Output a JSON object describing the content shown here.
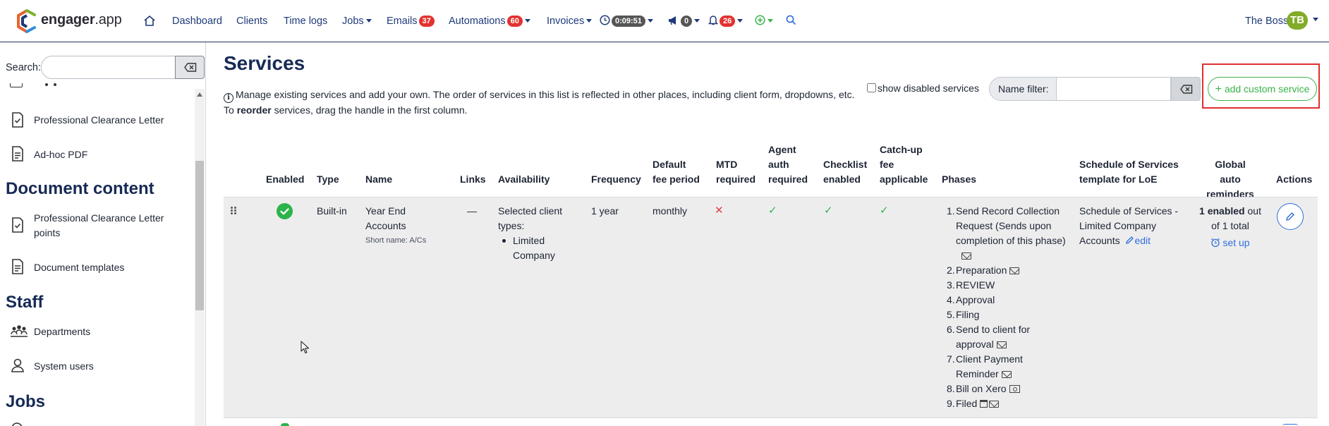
{
  "brand": {
    "name_bold": "engager",
    "name_suffix": ".app"
  },
  "nav": {
    "dashboard": "Dashboard",
    "clients": "Clients",
    "timelogs": "Time logs",
    "jobs": "Jobs",
    "emails": "Emails",
    "emails_count": "37",
    "automations": "Automations",
    "automations_count": "60",
    "invoices": "Invoices",
    "timer": "0:09:51",
    "announcements_count": "0",
    "notifications_count": "26",
    "user_name": "The Boss",
    "user_initials": "TB"
  },
  "sidebar": {
    "search_label": "Search:",
    "search_value": "",
    "items_top": [
      {
        "label": "Professional Clearance Letter",
        "icon": "document-check-icon"
      },
      {
        "label": "Ad-hoc PDF",
        "icon": "document-icon"
      }
    ],
    "section_document_content": "Document content",
    "items_doc_content": [
      {
        "label": "Professional Clearance Letter points",
        "icon": "document-check-icon"
      },
      {
        "label": "Document templates",
        "icon": "document-icon"
      }
    ],
    "section_staff": "Staff",
    "items_staff": [
      {
        "label": "Departments",
        "icon": "departments-icon"
      },
      {
        "label": "System users",
        "icon": "user-icon"
      }
    ],
    "section_jobs": "Jobs"
  },
  "main": {
    "title": "Services",
    "info_line1": "Manage existing services and add your own. The order of services in this list is reflected in other places, including client form, dropdowns, etc.",
    "info_line2_pre": "To ",
    "info_line2_bold": "reorder",
    "info_line2_post": " services, drag the handle in the first column.",
    "show_disabled_label": "show disabled services",
    "show_disabled_checked": false,
    "name_filter_label": "Name filter:",
    "name_filter_value": "",
    "add_button": "add custom service"
  },
  "table": {
    "headers": {
      "enabled": "Enabled",
      "type": "Type",
      "name": "Name",
      "links": "Links",
      "availability": "Availability",
      "frequency": "Frequency",
      "default_fee_period_1": "Default",
      "default_fee_period_2": "fee period",
      "mtd_1": "MTD",
      "mtd_2": "required",
      "agent_1": "Agent",
      "agent_2": "auth",
      "agent_3": "required",
      "checklist_1": "Checklist",
      "checklist_2": "enabled",
      "catchup_1": "Catch-up",
      "catchup_2": "fee",
      "catchup_3": "applicable",
      "phases": "Phases",
      "schedule_1": "Schedule of Services",
      "schedule_2": "template for LoE",
      "reminders_1": "Global auto",
      "reminders_2": "reminders",
      "actions": "Actions"
    },
    "rows": [
      {
        "enabled": true,
        "type": "Built-in",
        "name_1": "Year End",
        "name_2": "Accounts",
        "short_name": "Short name: A/Cs",
        "links": "—",
        "availability_1": "Selected client",
        "availability_2": "types:",
        "availability_item_1": "Limited",
        "availability_item_2": "Company",
        "frequency": "1 year",
        "default_fee_period": "monthly",
        "mtd_required": "✕",
        "agent_auth_required": "✓",
        "checklist_enabled": "✓",
        "catchup_fee_applicable": "✓",
        "phases": [
          {
            "num": "1.",
            "lines": [
              "Send Record Collection",
              "Request (Sends upon",
              "completion of this phase)"
            ],
            "icons": [
              "mail"
            ]
          },
          {
            "num": "2.",
            "lines": [
              "Preparation"
            ],
            "icons": [
              "mail"
            ]
          },
          {
            "num": "3.",
            "lines": [
              "REVIEW"
            ],
            "icons": []
          },
          {
            "num": "4.",
            "lines": [
              "Approval"
            ],
            "icons": []
          },
          {
            "num": "5.",
            "lines": [
              "Filing"
            ],
            "icons": []
          },
          {
            "num": "6.",
            "lines": [
              "Send to client for",
              "approval"
            ],
            "icons": [
              "mail"
            ]
          },
          {
            "num": "7.",
            "lines": [
              "Client Payment",
              "Reminder"
            ],
            "icons": [
              "mail"
            ]
          },
          {
            "num": "8.",
            "lines": [
              "Bill on Xero"
            ],
            "icons": [
              "money"
            ]
          },
          {
            "num": "9.",
            "lines": [
              "Filed"
            ],
            "icons": [
              "calendar",
              "mail"
            ]
          }
        ],
        "schedule_1": "Schedule of Services -",
        "schedule_2": "Limited Company",
        "schedule_3": "Accounts",
        "schedule_edit": "edit",
        "reminders_bold": "1 enabled",
        "reminders_rest_1": " out",
        "reminders_rest_2": "of 1 total",
        "reminders_setup": "set up"
      }
    ]
  }
}
